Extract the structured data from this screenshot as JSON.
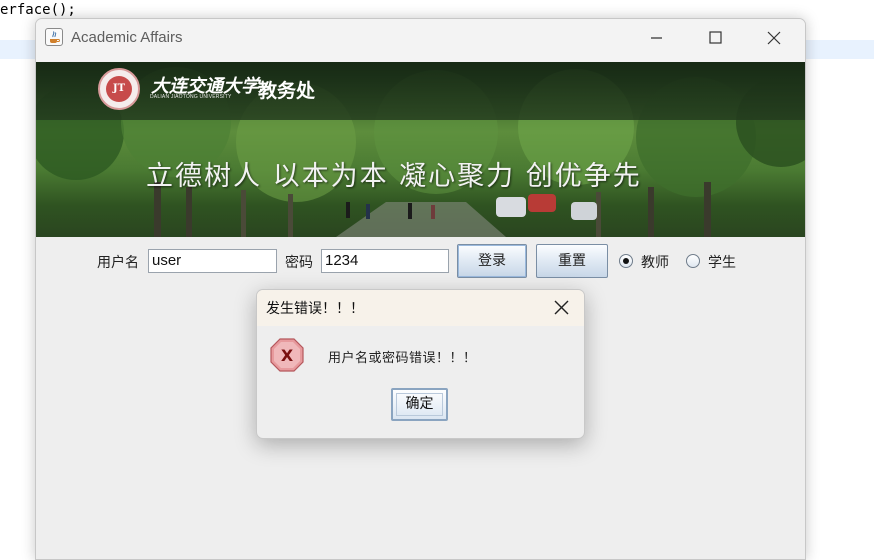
{
  "ide": {
    "code_line": "erface();"
  },
  "window": {
    "title": "Academic Affairs"
  },
  "banner": {
    "university_name_cn": "大连交通大学",
    "university_name_en": "DALIAN JIAOTONG UNIVERSITY",
    "logo_text": "JT",
    "department": "教务处",
    "slogan": "立德树人 以本为本 凝心聚力 创优争先"
  },
  "login": {
    "username_label": "用户名",
    "username_value": "user",
    "password_label": "密码",
    "password_value": "1234",
    "login_button": "登录",
    "reset_button": "重置",
    "role_teacher": "教师",
    "role_student": "学生",
    "selected_role": "教师"
  },
  "dialog": {
    "title": "发生错误！！！",
    "message": "用户名或密码错误！！！",
    "ok_button": "确定",
    "icon": "error-icon"
  },
  "colors": {
    "error_red": "#d9444a",
    "button_gradient_bottom": "#c8d7e8",
    "dialog_title_bg": "#f7f2ea"
  }
}
